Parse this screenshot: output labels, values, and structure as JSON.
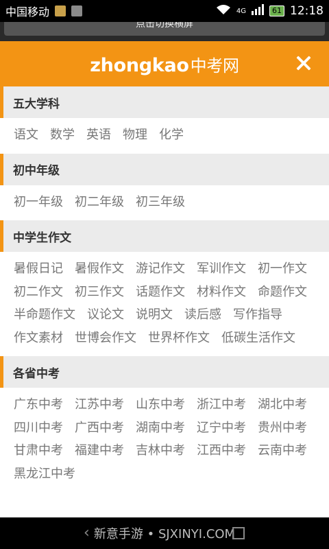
{
  "status_bar": {
    "carrier": "中国移动",
    "network": "4G",
    "battery": "61",
    "time": "12:18",
    "notification_colors": [
      "#c8a04a",
      "#8a8a8a"
    ]
  },
  "peek_bar": {
    "label": "点击切换横屏"
  },
  "header": {
    "brand_en": "zhongkao",
    "brand_cn": "中考网",
    "accent_color": "#f39414",
    "close_icon": "close-icon"
  },
  "sections": [
    {
      "title": "五大学科",
      "links": [
        "语文",
        "数学",
        "英语",
        "物理",
        "化学"
      ]
    },
    {
      "title": "初中年级",
      "links": [
        "初一年级",
        "初二年级",
        "初三年级"
      ]
    },
    {
      "title": "中学生作文",
      "links": [
        "暑假日记",
        "暑假作文",
        "游记作文",
        "军训作文",
        "初一作文",
        "初二作文",
        "初三作文",
        "话题作文",
        "材料作文",
        "命题作文",
        "半命题作文",
        "议论文",
        "说明文",
        "读后感",
        "写作指导",
        "作文素材",
        "世博会作文",
        "世界杯作文",
        "低碳生活作文"
      ]
    },
    {
      "title": "各省中考",
      "links": [
        "广东中考",
        "江苏中考",
        "山东中考",
        "浙江中考",
        "湖北中考",
        "四川中考",
        "广西中考",
        "湖南中考",
        "辽宁中考",
        "贵州中考",
        "甘肃中考",
        "福建中考",
        "吉林中考",
        "江西中考",
        "云南中考",
        "黑龙江中考"
      ]
    }
  ],
  "nav_bar": {
    "watermark": "新意手游 • SJXINYI.COM",
    "back_icon": "back-icon",
    "recent_icon": "recent-apps-icon"
  }
}
